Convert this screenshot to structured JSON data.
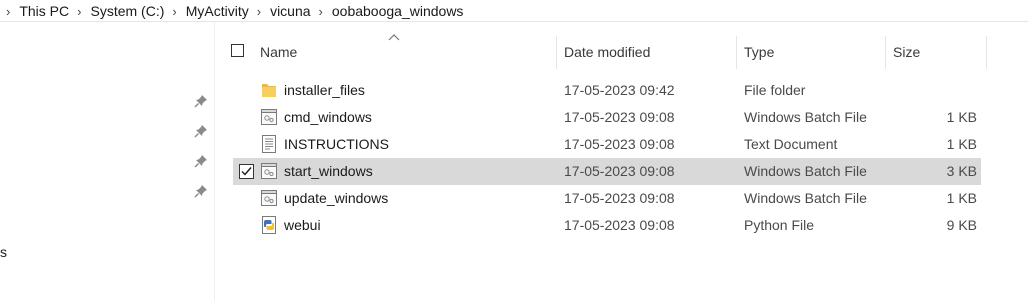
{
  "breadcrumb": [
    "This PC",
    "System (C:)",
    "MyActivity",
    "vicuna",
    "oobabooga_windows"
  ],
  "nav_pane": {
    "partial_label": "s"
  },
  "columns": {
    "name": "Name",
    "date": "Date modified",
    "type": "Type",
    "size": "Size"
  },
  "files": [
    {
      "name": "installer_files",
      "date": "17-05-2023 09:42",
      "type": "File folder",
      "size": "",
      "icon": "folder-icon",
      "selected": false
    },
    {
      "name": "cmd_windows",
      "date": "17-05-2023 09:08",
      "type": "Windows Batch File",
      "size": "1 KB",
      "icon": "batch-file-icon",
      "selected": false
    },
    {
      "name": "INSTRUCTIONS",
      "date": "17-05-2023 09:08",
      "type": "Text Document",
      "size": "1 KB",
      "icon": "text-document-icon",
      "selected": false
    },
    {
      "name": "start_windows",
      "date": "17-05-2023 09:08",
      "type": "Windows Batch File",
      "size": "3 KB",
      "icon": "batch-file-icon",
      "selected": true
    },
    {
      "name": "update_windows",
      "date": "17-05-2023 09:08",
      "type": "Windows Batch File",
      "size": "1 KB",
      "icon": "batch-file-icon",
      "selected": false
    },
    {
      "name": "webui",
      "date": "17-05-2023 09:08",
      "type": "Python File",
      "size": "9 KB",
      "icon": "python-file-icon",
      "selected": false
    }
  ]
}
